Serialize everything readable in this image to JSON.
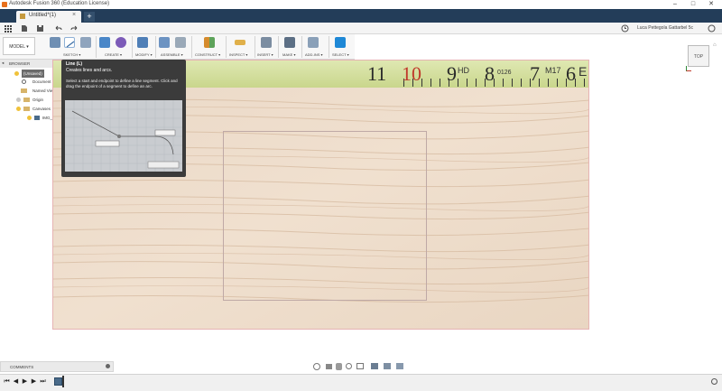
{
  "window": {
    "title": "Autodesk Fusion 360 (Education License)",
    "minimize": "–",
    "maximize": "□",
    "close": "✕"
  },
  "tabs": [
    {
      "label": "Untitled*(1)",
      "close": "×"
    }
  ],
  "new_tab": "+",
  "quick_access": {
    "grid": "grid-icon",
    "file": "file-icon",
    "save": "save-icon",
    "undo": "undo-icon",
    "redo": "redo-icon",
    "user": "Luca Pettegola Gattarbel 5c",
    "help": "?"
  },
  "workspace": {
    "label": "MODEL ▾"
  },
  "toolbar_groups": [
    {
      "label": "SKETCH ▾"
    },
    {
      "label": "CREATE ▾"
    },
    {
      "label": "MODIFY ▾"
    },
    {
      "label": "ASSEMBLE ▾"
    },
    {
      "label": "CONSTRUCT ▾"
    },
    {
      "label": "INSPECT ▾"
    },
    {
      "label": "INSERT ▾"
    },
    {
      "label": "MAKE ▾"
    },
    {
      "label": "ADD-INS ▾"
    },
    {
      "label": "SELECT ▾"
    }
  ],
  "browser": {
    "header": "BROWSER",
    "items": [
      {
        "label": "(Unsaved)"
      },
      {
        "label": "Document Settings"
      },
      {
        "label": "Named Views"
      },
      {
        "label": "Origin"
      },
      {
        "label": "Canvases"
      },
      {
        "label": "IMG_0..."
      }
    ]
  },
  "ruler": {
    "numbers": [
      "11",
      "10",
      "9",
      "8",
      "7",
      "6"
    ],
    "annotations": [
      "HD",
      "0126",
      "M17",
      "E"
    ]
  },
  "tooltip": {
    "title": "Line (L)",
    "subtitle": "Creates lines and arcs.",
    "description": "Select a start and endpoint to define a line segment. Click and drag the endpoint of a segment to define an arc.",
    "preview_labels": [
      "",
      "",
      "",
      ""
    ]
  },
  "viewcube": {
    "label": "TOP"
  },
  "comments": {
    "label": "COMMENTS"
  },
  "colors": {
    "tabbar": "#233d59",
    "accent": "#0696d7",
    "tooltip_bg": "#3b3b3b",
    "ruler": "#d3de9c"
  }
}
